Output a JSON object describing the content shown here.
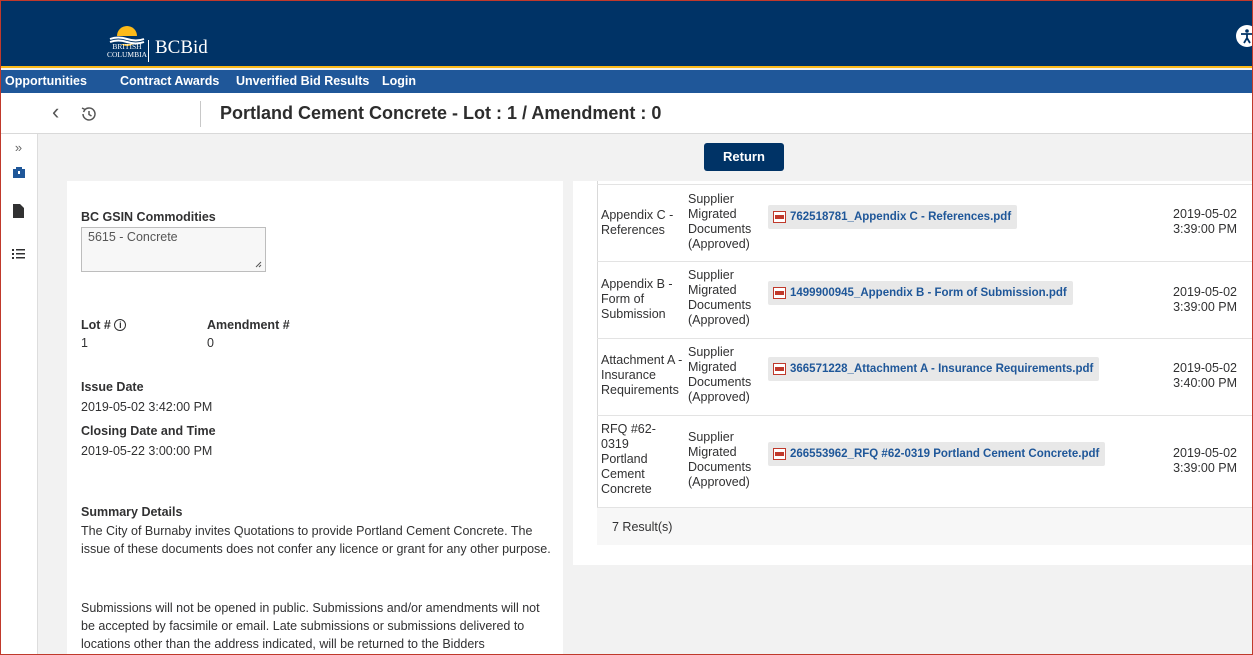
{
  "header": {
    "logo_text_line1": "BRITISH",
    "logo_text_line2": "COLUMBIA",
    "brand": "BCBid"
  },
  "nav": {
    "opportunities": "Opportunities",
    "contract_awards": "Contract Awards",
    "unverified": "Unverified Bid Results",
    "login": "Login"
  },
  "titlebar": {
    "title": "Portland Cement Concrete - Lot : 1 / Amendment : 0"
  },
  "actions": {
    "return_label": "Return"
  },
  "details": {
    "gsin_label": "BC GSIN Commodities",
    "gsin_value": "5615 - Concrete",
    "lot_label": "Lot #",
    "lot_value": "1",
    "amendment_label": "Amendment #",
    "amendment_value": "0",
    "issue_label": "Issue Date",
    "issue_value": "2019-05-02 3:42:00 PM",
    "closing_label": "Closing Date and Time",
    "closing_value": "2019-05-22 3:00:00 PM",
    "summary_label": "Summary Details",
    "summary_p1": "The City of Burnaby invites Quotations to provide Portland Cement Concrete. The issue of these documents does not confer any licence or grant for any other purpose.",
    "summary_p2": "Submissions will not be opened in public. Submissions and/or amendments will not be accepted by facsimile or email. Late submissions or submissions delivered to locations other than the address indicated, will be returned to the Bidders"
  },
  "documents": {
    "rows": [
      {
        "name": "Appendix C - References",
        "type": "Supplier Migrated Documents (Approved)",
        "file": "762518781_Appendix C - References.pdf",
        "date": "2019-05-02",
        "time": "3:39:00 PM"
      },
      {
        "name": "Appendix B - Form of Submission",
        "type": "Supplier Migrated Documents (Approved)",
        "file": "1499900945_Appendix B - Form of Submission.pdf",
        "date": "2019-05-02",
        "time": "3:39:00 PM"
      },
      {
        "name": "Attachment A - Insurance Requirements",
        "type": "Supplier Migrated Documents (Approved)",
        "file": "366571228_Attachment A - Insurance Requirements.pdf",
        "date": "2019-05-02",
        "time": "3:40:00 PM"
      },
      {
        "name": "RFQ #62-0319 Portland Cement Concrete",
        "type": "Supplier Migrated Documents (Approved)",
        "file": "266553962_RFQ #62-0319 Portland Cement Concrete.pdf",
        "date": "2019-05-02",
        "time": "3:39:00 PM"
      }
    ],
    "results": "7 Result(s)"
  }
}
